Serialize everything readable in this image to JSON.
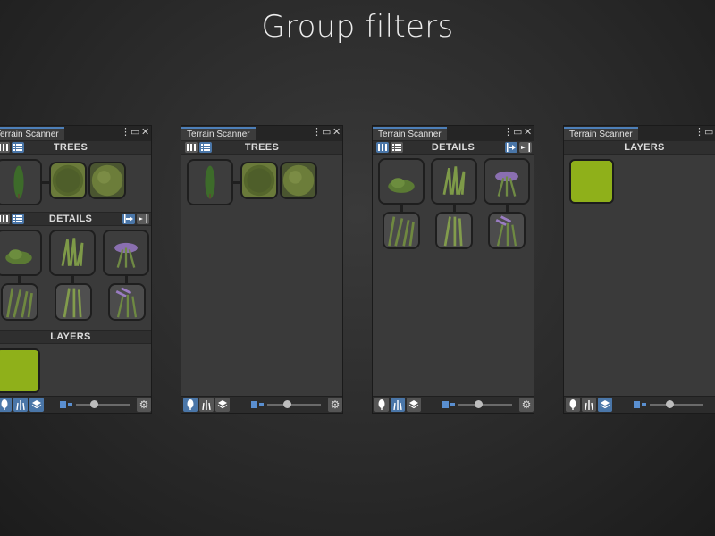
{
  "page": {
    "title": "Group filters"
  },
  "panels": [
    {
      "tab_title": "Terrain Scanner",
      "sections": [
        "TREES",
        "DETAILS",
        "LAYERS"
      ],
      "active_filters": [
        "trees",
        "details",
        "layers"
      ]
    },
    {
      "tab_title": "Terrain Scanner",
      "sections": [
        "TREES"
      ],
      "active_filters": [
        "trees"
      ]
    },
    {
      "tab_title": "Terrain Scanner",
      "sections": [
        "DETAILS"
      ],
      "active_filters": [
        "details"
      ]
    },
    {
      "tab_title": "Terrain Scanner",
      "sections": [
        "LAYERS"
      ],
      "active_filters": [
        "layers"
      ]
    }
  ],
  "icons": {
    "window_menu": "kebab-menu-icon",
    "window_maximize": "maximize-icon",
    "window_close": "close-icon",
    "filter_trees": "tree-icon",
    "filter_details": "grass-icon",
    "filter_layers": "layers-icon",
    "settings": "gear-icon",
    "thumbnail_size": "thumbnail-size-icon"
  },
  "colors": {
    "accent": "#4a76a8",
    "layer_swatch": "#8fb01a",
    "panel_bg": "#3a3a3a"
  }
}
